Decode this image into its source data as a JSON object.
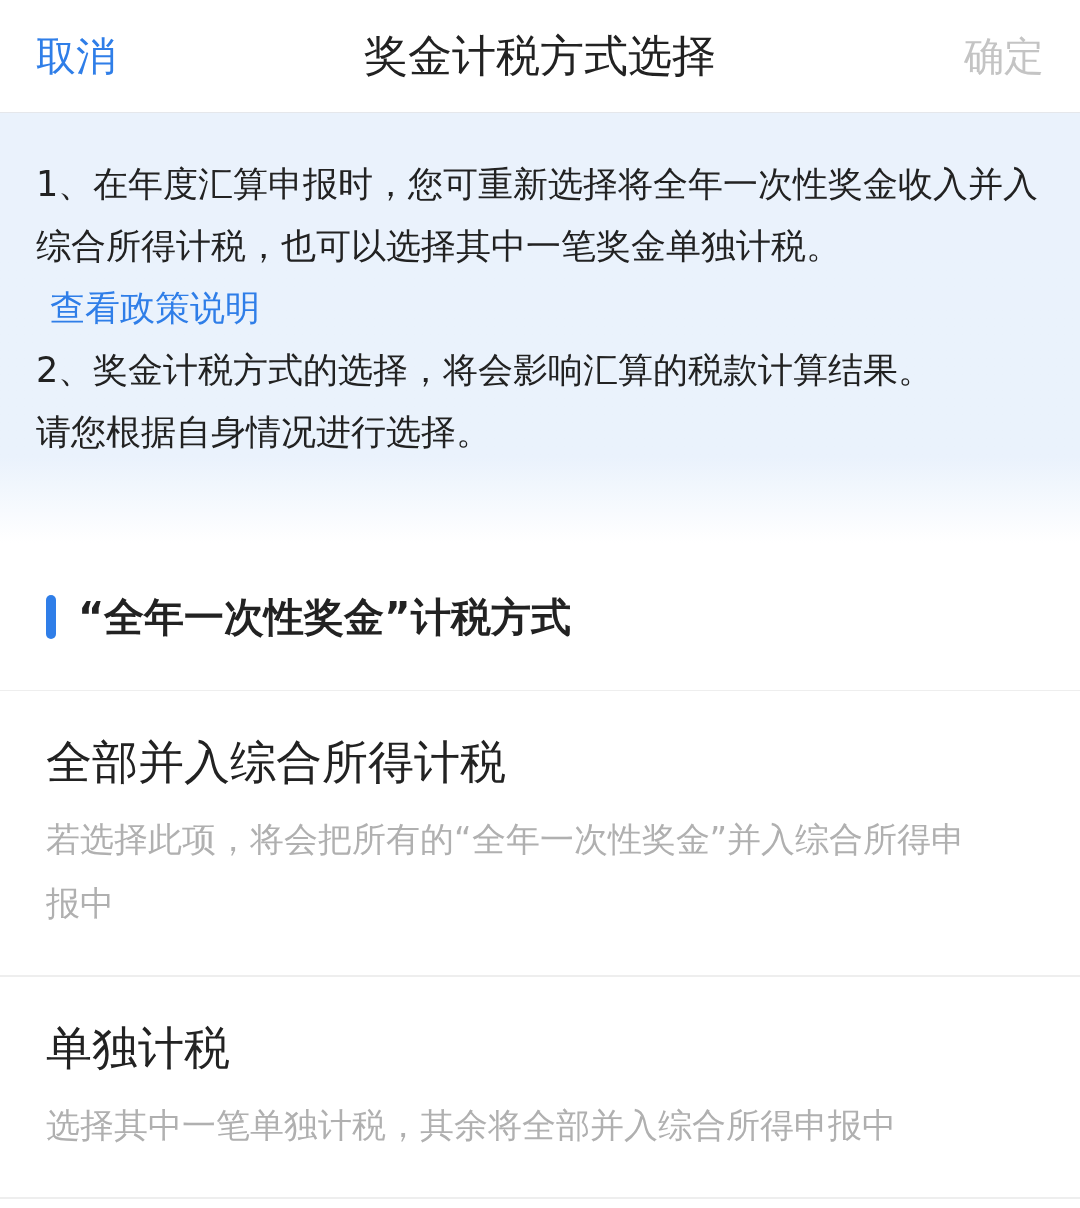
{
  "header": {
    "cancel": "取消",
    "title": "奖金计税方式选择",
    "confirm": {
      "label": "确定",
      "disabled": true
    }
  },
  "notice": {
    "paragraphs": [
      {
        "text": "1、在年度汇算申报时，您可重新选择将全年一次性奖金收入并入综合所得计税，也可以选择其中一笔奖金单独计税。",
        "link": "查看政策说明"
      },
      {
        "text": "2、奖金计税方式的选择，将会影响汇算的税款计算结果。"
      },
      {
        "text": "请您根据自身情况进行选择。"
      }
    ]
  },
  "section": {
    "title": "“全年一次性奖金”计税方式"
  },
  "options": [
    {
      "title": "全部并入综合所得计税",
      "description": "若选择此项，将会把所有的“全年一次性奖金”并入综合所得申报中"
    },
    {
      "title": "单独计税",
      "description": "选择其中一笔单独计税，其余将全部并入综合所得申报中"
    }
  ]
}
